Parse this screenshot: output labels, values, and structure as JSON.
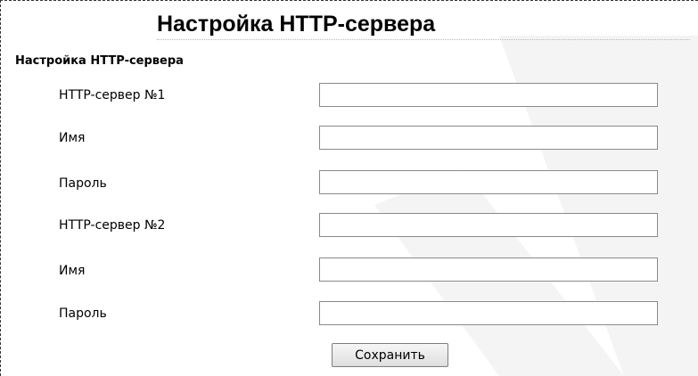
{
  "page": {
    "title": "Настройка HTTP-сервера",
    "section_heading": "Настройка HTTP-сервера"
  },
  "form": {
    "fields": [
      {
        "label": "HTTP-сервер №1",
        "value": ""
      },
      {
        "label": "Имя",
        "value": ""
      },
      {
        "label": "Пароль",
        "value": ""
      },
      {
        "label": "HTTP-сервер №2",
        "value": ""
      },
      {
        "label": "Имя",
        "value": ""
      },
      {
        "label": "Пароль",
        "value": ""
      }
    ],
    "save_label": "Сохранить"
  },
  "colors": {
    "background": "#ffffff",
    "text": "#000000",
    "input_border": "#8a8a8a",
    "watermark": "#f3f3f3"
  }
}
